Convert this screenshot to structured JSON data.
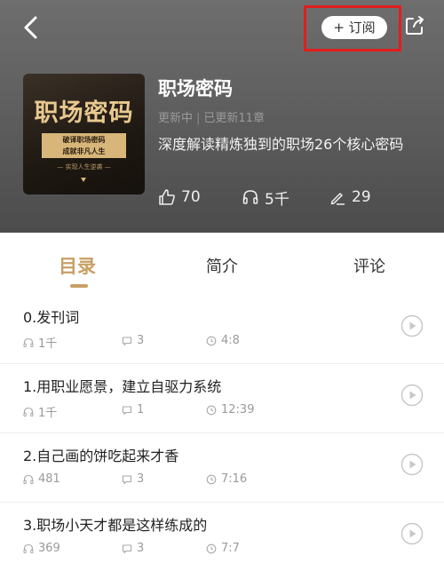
{
  "header": {
    "subscribe_label": "+ 订阅",
    "colors": {
      "highlight": "#e21d1d",
      "accent": "#c8a065"
    }
  },
  "cover": {
    "title": "职场密码",
    "plaque_line1": "破译职场密码",
    "plaque_line2": "成就非凡人生",
    "tag": "— 实现人生逆袭 —"
  },
  "album": {
    "title": "职场密码",
    "status": "更新中",
    "updated": "已更新11章",
    "description": "深度解读精炼独到的职场26个核心密码"
  },
  "stats": {
    "likes": "70",
    "listens": "5千",
    "comments": "29"
  },
  "tabs": [
    {
      "label": "目录",
      "active": true
    },
    {
      "label": "简介",
      "active": false
    },
    {
      "label": "评论",
      "active": false
    }
  ],
  "episodes": [
    {
      "title": "0.发刊词",
      "listens": "1千",
      "comments": "3",
      "duration": "4:8"
    },
    {
      "title": "1.用职业愿景，建立自驱力系统",
      "listens": "1千",
      "comments": "1",
      "duration": "12:39"
    },
    {
      "title": "2.自己画的饼吃起来才香",
      "listens": "481",
      "comments": "3",
      "duration": "7:16"
    },
    {
      "title": "3.职场小天才都是这样练成的",
      "listens": "369",
      "comments": "3",
      "duration": "7:7"
    }
  ],
  "icons": {
    "back": "chevron-left-icon",
    "share": "share-icon",
    "like": "thumbs-up-icon",
    "listen": "headphones-icon",
    "comment": "pencil-icon",
    "play": "play-circle-icon"
  }
}
